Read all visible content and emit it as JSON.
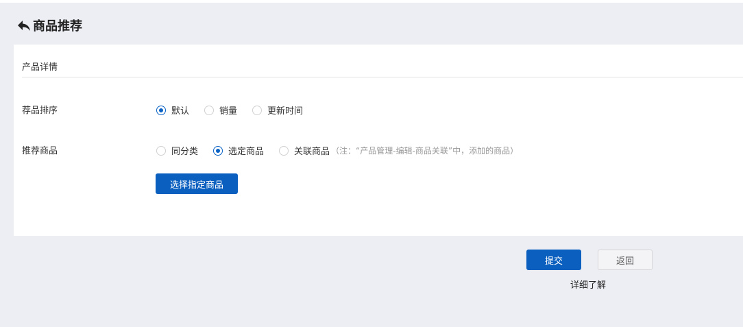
{
  "header": {
    "title": "商品推荐",
    "back_icon": "back-arrow-icon"
  },
  "panel": {
    "section_title": "产品详情",
    "sort": {
      "label": "荐品排序",
      "options": [
        {
          "label": "默认",
          "checked": true
        },
        {
          "label": "销量",
          "checked": false
        },
        {
          "label": "更新时间",
          "checked": false
        }
      ]
    },
    "recommend": {
      "label": "推荐商品",
      "options": [
        {
          "label": "同分类",
          "checked": false
        },
        {
          "label": "选定商品",
          "checked": true
        },
        {
          "label": "关联商品",
          "checked": false
        }
      ],
      "note": "（注：“产品管理-编辑-商品关联”中，添加的商品）",
      "select_button": "选择指定商品"
    }
  },
  "footer": {
    "submit": "提交",
    "back": "返回",
    "learn_more": "详细了解"
  },
  "colors": {
    "primary": "#0a5fbf",
    "background": "#edeef3",
    "panel": "#ffffff"
  }
}
